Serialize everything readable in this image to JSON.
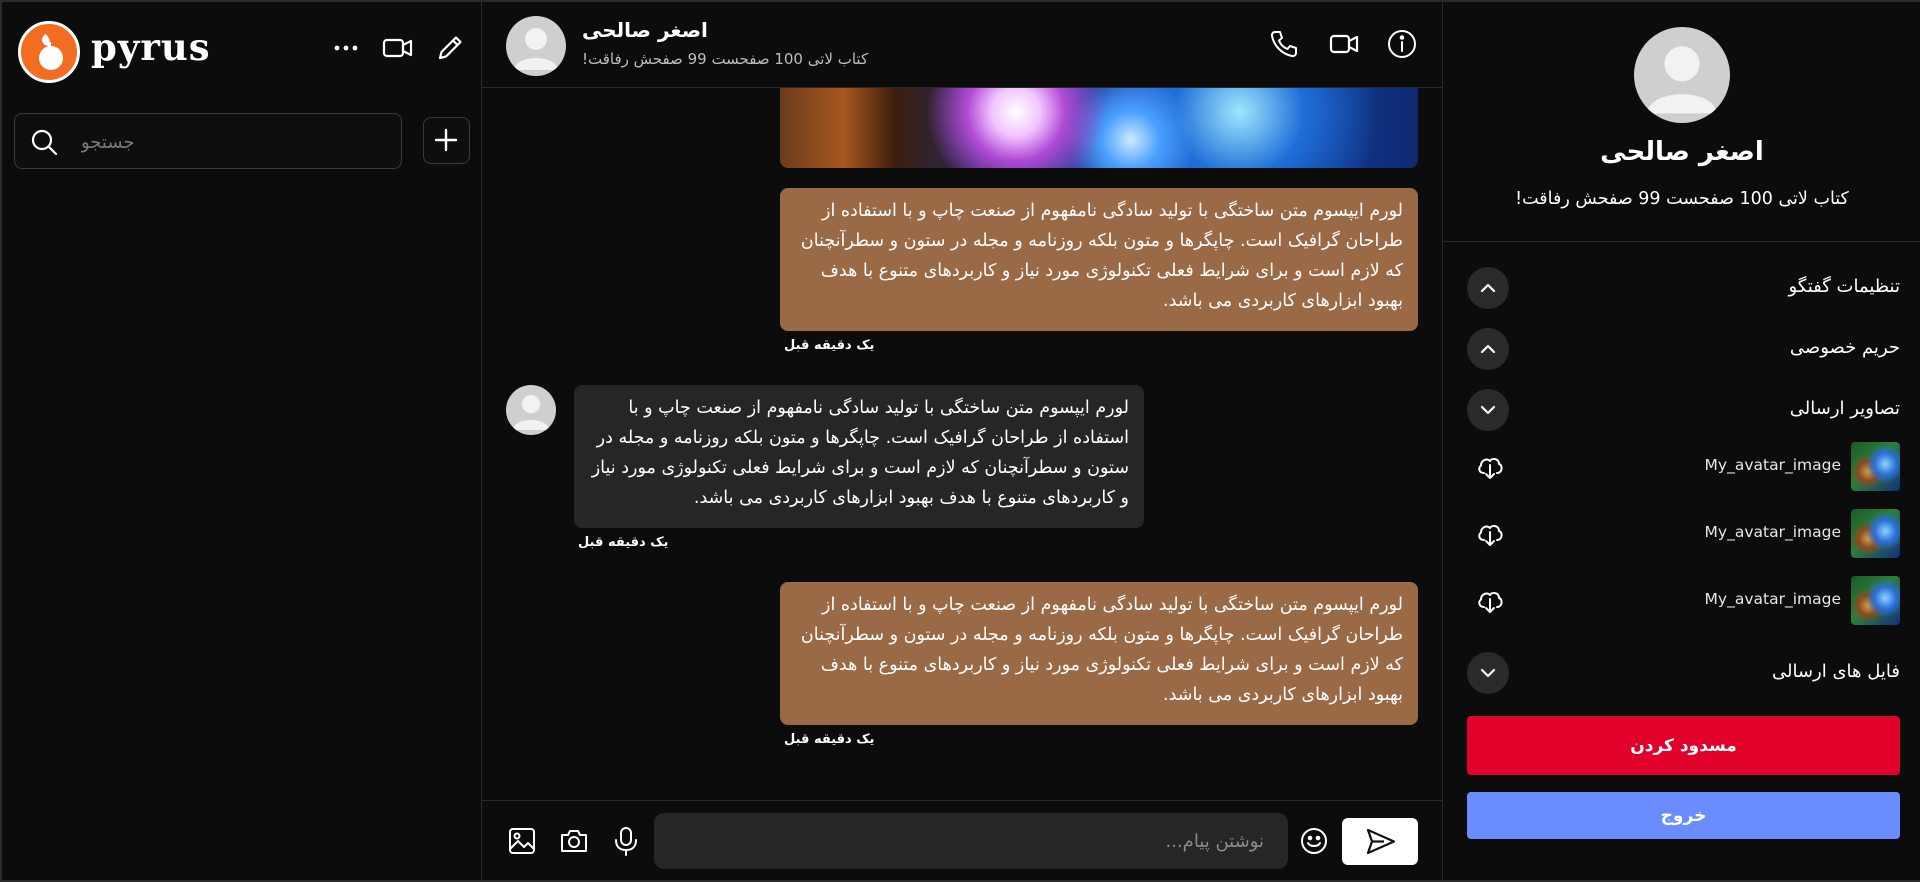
{
  "app": {
    "brand": "pyrus"
  },
  "sidebar": {
    "search_placeholder": "جستجو",
    "icons": [
      "more-icon",
      "video-icon",
      "edit-icon",
      "search-icon",
      "plus-icon"
    ]
  },
  "chat": {
    "contact_name": "اصغر صالحی",
    "contact_status": "کتاب لاتی 100 صفحست 99 صفحش رفاقت!",
    "messages": [
      {
        "type": "image",
        "direction": "out"
      },
      {
        "direction": "out",
        "text": "لورم ایپسوم متن ساختگی با تولید سادگی نامفهوم از صنعت چاپ و با استفاده از طراحان گرافیک است. چاپگرها و متون بلکه روزنامه و مجله در ستون و سطرآنچنان که لازم است و برای شرایط فعلی تکنولوژی مورد نیاز و کاربردهای متنوع با هدف بهبود ابزارهای کاربردی می باشد.",
        "time": "یک دقیقه قبل"
      },
      {
        "direction": "in",
        "text": "لورم ایپسوم متن ساختگی با تولید سادگی نامفهوم از صنعت چاپ و با استفاده از طراحان گرافیک است. چاپگرها و متون بلکه روزنامه و مجله در ستون و سطرآنچنان که لازم است و برای شرایط فعلی تکنولوژی مورد نیاز و کاربردهای متنوع با هدف بهبود ابزارهای کاربردی می باشد.",
        "time": "یک دقیقه قبل"
      },
      {
        "direction": "out",
        "text": "لورم ایپسوم متن ساختگی با تولید سادگی نامفهوم از صنعت چاپ و با استفاده از طراحان گرافیک است. چاپگرها و متون بلکه روزنامه و مجله در ستون و سطرآنچنان که لازم است و برای شرایط فعلی تکنولوژی مورد نیاز و کاربردهای متنوع با هدف بهبود ابزارهای کاربردی می باشد.",
        "time": "یک دقیقه قبل"
      }
    ],
    "composer_placeholder": "نوشتن پیام..."
  },
  "panel": {
    "name": "اصغر صالحی",
    "status": "کتاب لاتی 100 صفحست 99 صفحش رفاقت!",
    "sections": {
      "chat_settings": "تنظیمات گفتگو",
      "privacy": "حریم خصوصی",
      "sent_images": "تصاویر ارسالی",
      "sent_files": "فایل های ارسالی"
    },
    "images": [
      {
        "name": "My_avatar_image"
      },
      {
        "name": "My_avatar_image"
      },
      {
        "name": "My_avatar_image"
      }
    ],
    "block_label": "مسدود کردن",
    "logout_label": "خروج"
  },
  "colors": {
    "outgoing_bubble": "#9a6a46",
    "incoming_bubble": "#262626",
    "block_button": "#e2012b",
    "logout_button": "#6b8cff",
    "brand_orange": "#f26d21"
  }
}
